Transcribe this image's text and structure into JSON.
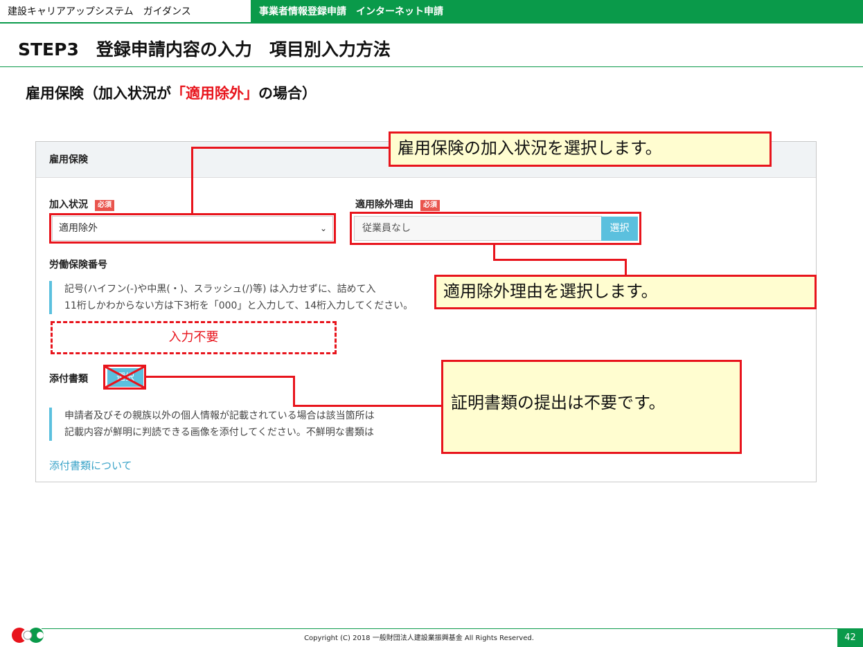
{
  "topbar": {
    "left": "建設キャリアアップシステム　ガイダンス",
    "right": "事業者情報登録申請　インターネット申請"
  },
  "page_title": "STEP3　登録申請内容の入力　項目別入力方法",
  "section": {
    "prefix": "雇用保険（加入状況が",
    "highlight": "「適用除外」",
    "suffix": "の場合）"
  },
  "panel": {
    "header": "雇用保険",
    "required_badge": "必須",
    "enrollment": {
      "label": "加入状況",
      "value": "適用除外"
    },
    "exclusion_reason": {
      "label": "適用除外理由",
      "value": "従業員なし",
      "button": "選択"
    },
    "insurance_number": {
      "label": "労働保険番号",
      "note_line1": "記号(ハイフン(-)や中黒(・)、スラッシュ(/)等) は入力せずに、詰めて入",
      "note_line2": "11桁しかわからない方は下3桁を「000」と入力して、14桁入力してください。"
    },
    "attachments": {
      "label": "添付書類",
      "button": "選択",
      "note_line1": "申請者及びその親族以外の個人情報が記載されている場合は該当箇所は",
      "note_line2": "記載内容が鮮明に判読できる画像を添付してください。不鮮明な書類は",
      "link": "添付書類について"
    }
  },
  "annotations": {
    "callout_enrollment": "雇用保険の加入状況を選択します。",
    "callout_reason": "適用除外理由を選択します。",
    "no_input": "入力不要",
    "callout_attachment": "証明書類の提出は不要です。"
  },
  "footer": {
    "copyright": "Copyright (C) 2018 一般財団法人建設業振興基金 All Rights Reserved.",
    "page_number": "42"
  },
  "colors": {
    "brand_green": "#0a9a4a",
    "annotation_red": "#e8141c",
    "button_blue": "#5bc0de",
    "callout_yellow": "#fffdd0"
  }
}
